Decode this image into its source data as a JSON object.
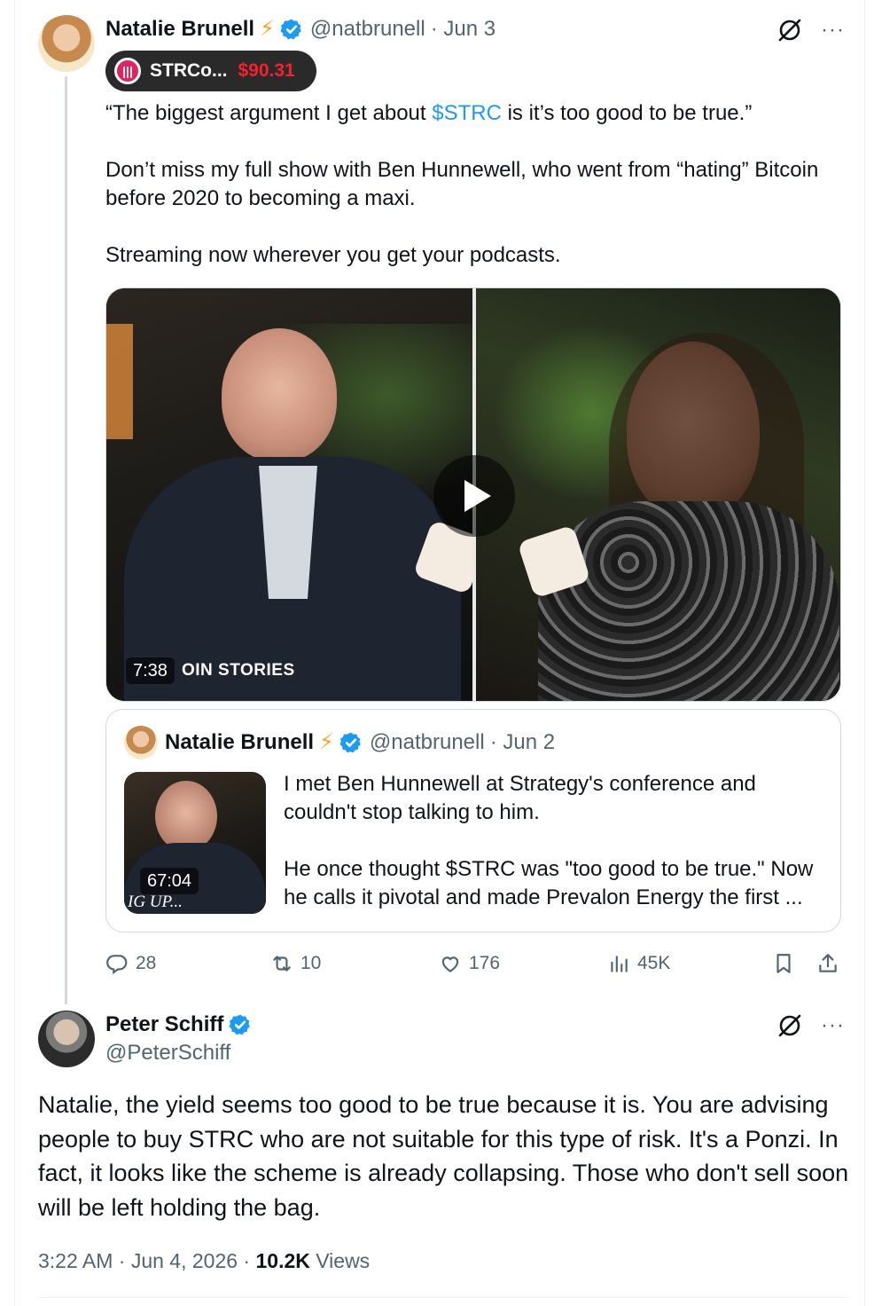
{
  "post": {
    "author_name": "Natalie Brunell",
    "author_badge": "⚡",
    "handle": "@natbrunell",
    "date": "· Jun 3",
    "grok_icon": "grok-icon",
    "more_icon": "more-icon",
    "more_label": "···",
    "ticker": {
      "logo_text": "|||",
      "symbol": "STRCo...",
      "price": "$90.31",
      "price_color": "#f4212e"
    },
    "text": {
      "line1_pre": "“The biggest argument I get about ",
      "line1_link": "$STRC",
      "line1_post": " is it’s too good to be true.”",
      "para2": "Don’t miss my full show with Ben Hunnewell, who went from “hating” Bitcoin before 2020 to becoming a maxi.",
      "para3": "Streaming now wherever you get your podcasts."
    },
    "video": {
      "duration": "7:38",
      "overlay_text": "OIN STORIES"
    },
    "quote": {
      "author_name": "Natalie Brunell",
      "author_badge": "⚡",
      "handle": "@natbrunell",
      "date": "· Jun 2",
      "thumb_duration": "67:04",
      "thumb_overlay": "IG UP...",
      "para1": "I met Ben Hunnewell at Strategy's conference and couldn't stop talking to him.",
      "para2_line1": "He once thought $STRC was \"too good to be true.\" Now",
      "para2_line2": "he calls it pivotal and made Prevalon Energy the first ..."
    },
    "actions": {
      "replies": "28",
      "reposts": "10",
      "likes": "176",
      "views": "45K"
    }
  },
  "reply": {
    "author_name": "Peter Schiff",
    "handle": "@PeterSchiff",
    "more_label": "···",
    "text": "Natalie, the yield seems too good to be true because it is. You are advising people to buy STRC who are not suitable for this type of risk. It's a Ponzi. In fact, it looks like the scheme is already collapsing. Those who don't sell soon will be left holding the bag.",
    "time": "3:22 AM",
    "date": "· Jun 4, 2026 ·",
    "views_count": "10.2K",
    "views_label": "Views"
  },
  "colors": {
    "link": "#1d9bf0",
    "muted": "#536471",
    "verified": "#1d9bf0"
  }
}
